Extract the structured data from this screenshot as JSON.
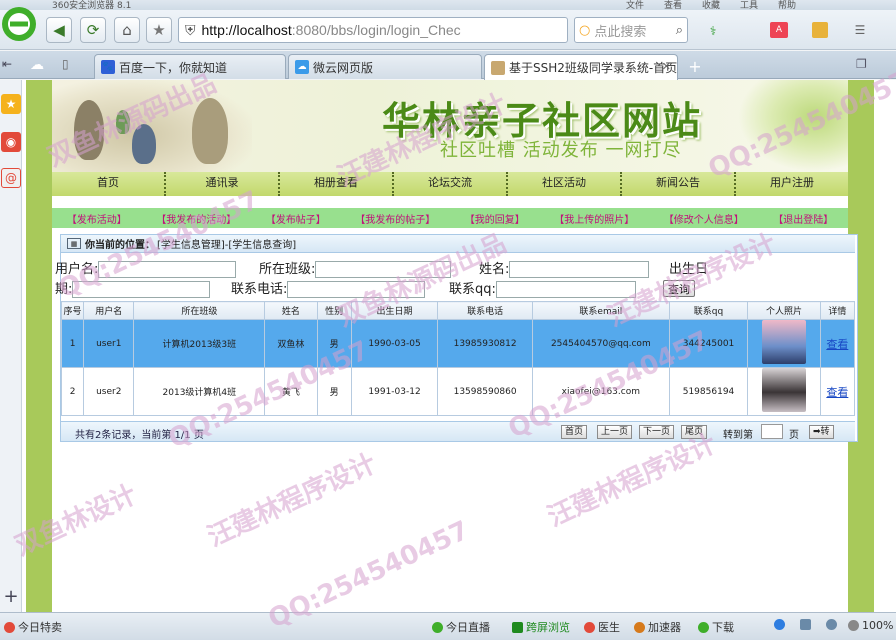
{
  "browser": {
    "window_title": "360安全浏览器 8.1",
    "title_menus": [
      "文件",
      "查看",
      "收藏",
      "工具",
      "帮助"
    ],
    "url_host": "http://localhost",
    "url_rest": ":8080/bbs/login/login_Chec",
    "search_placeholder": "点此搜索",
    "tabs": [
      {
        "label": "百度一下，你就知道",
        "active": false
      },
      {
        "label": "微云网页版",
        "active": false
      },
      {
        "label": "基于SSH2班级同学录系统-首页",
        "active": true
      }
    ]
  },
  "site": {
    "title": "华林亲子社区网站",
    "slogan": "社区吐槽 活动发布 一网打尽",
    "main_nav": [
      "首页",
      "通讯录",
      "相册查看",
      "论坛交流",
      "社区活动",
      "新闻公告",
      "用户注册"
    ],
    "sub_nav": [
      "【发布活动】",
      "【我发布的活动】",
      "【发布帖子】",
      "【我发布的帖子】",
      "【我的回复】",
      "【我上传的照片】",
      "【修改个人信息】",
      "【退出登陆】"
    ]
  },
  "panel": {
    "location_label": "你当前的位置：",
    "location_path": "[学生信息管理]-[学生信息查询]"
  },
  "filter_form": {
    "username_label": "用户名:",
    "class_label": "所在班级:",
    "name_label": "姓名:",
    "birthday_label_1": "出生日",
    "birthday_label_2": "期:",
    "phone_label": "联系电话:",
    "qq_label": "联系qq:",
    "query_button": "查询"
  },
  "table": {
    "headers": [
      "序号",
      "用户名",
      "所在班级",
      "姓名",
      "性别",
      "出生日期",
      "联系电话",
      "联系email",
      "联系qq",
      "个人照片",
      "详情"
    ],
    "rows": [
      {
        "no": "1",
        "username": "user1",
        "class": "计算机2013级3班",
        "name": "双鱼林",
        "gender": "男",
        "birthday": "1990-03-05",
        "phone": "13985930812",
        "email": "2545404570@qq.com",
        "qq": "344245001",
        "detail": "查看",
        "selected": true
      },
      {
        "no": "2",
        "username": "user2",
        "class": "2013级计算机4班",
        "name": "黄飞",
        "gender": "男",
        "birthday": "1991-03-12",
        "phone": "13598590860",
        "email": "xiaofei@163.com",
        "qq": "519856194",
        "detail": "查看",
        "selected": false
      }
    ]
  },
  "pager": {
    "info": "共有2条记录，当前第 1/1 页",
    "first": "首页",
    "prev": "上一页",
    "next": "下一页",
    "last": "尾页",
    "goto_label": "转到第",
    "page_unit": "页",
    "go_button": "➡转"
  },
  "statusbar": {
    "left": "今日特卖",
    "live": "今日直播",
    "cross_screen": "跨屏浏览",
    "doctor": "医生",
    "accelerator": "加速器",
    "download": "下载",
    "zoom": "100%"
  },
  "watermarks": [
    "双鱼林源码出品",
    "汪建林程序设计",
    "QQ:254540457",
    "QQ:254540457",
    "汪建林程序设计",
    "双鱼林源码出品",
    "QQ:254540457",
    "QQ:254540457",
    "汪建林程序设计",
    "双鱼林设计",
    "QQ:254540457",
    "汪建林程序设计"
  ],
  "colors": {
    "page_green": "#a8c95a",
    "selected_row": "#55a9ec",
    "subnav_text": "#c0117a",
    "title_green": "#4b8a17"
  }
}
